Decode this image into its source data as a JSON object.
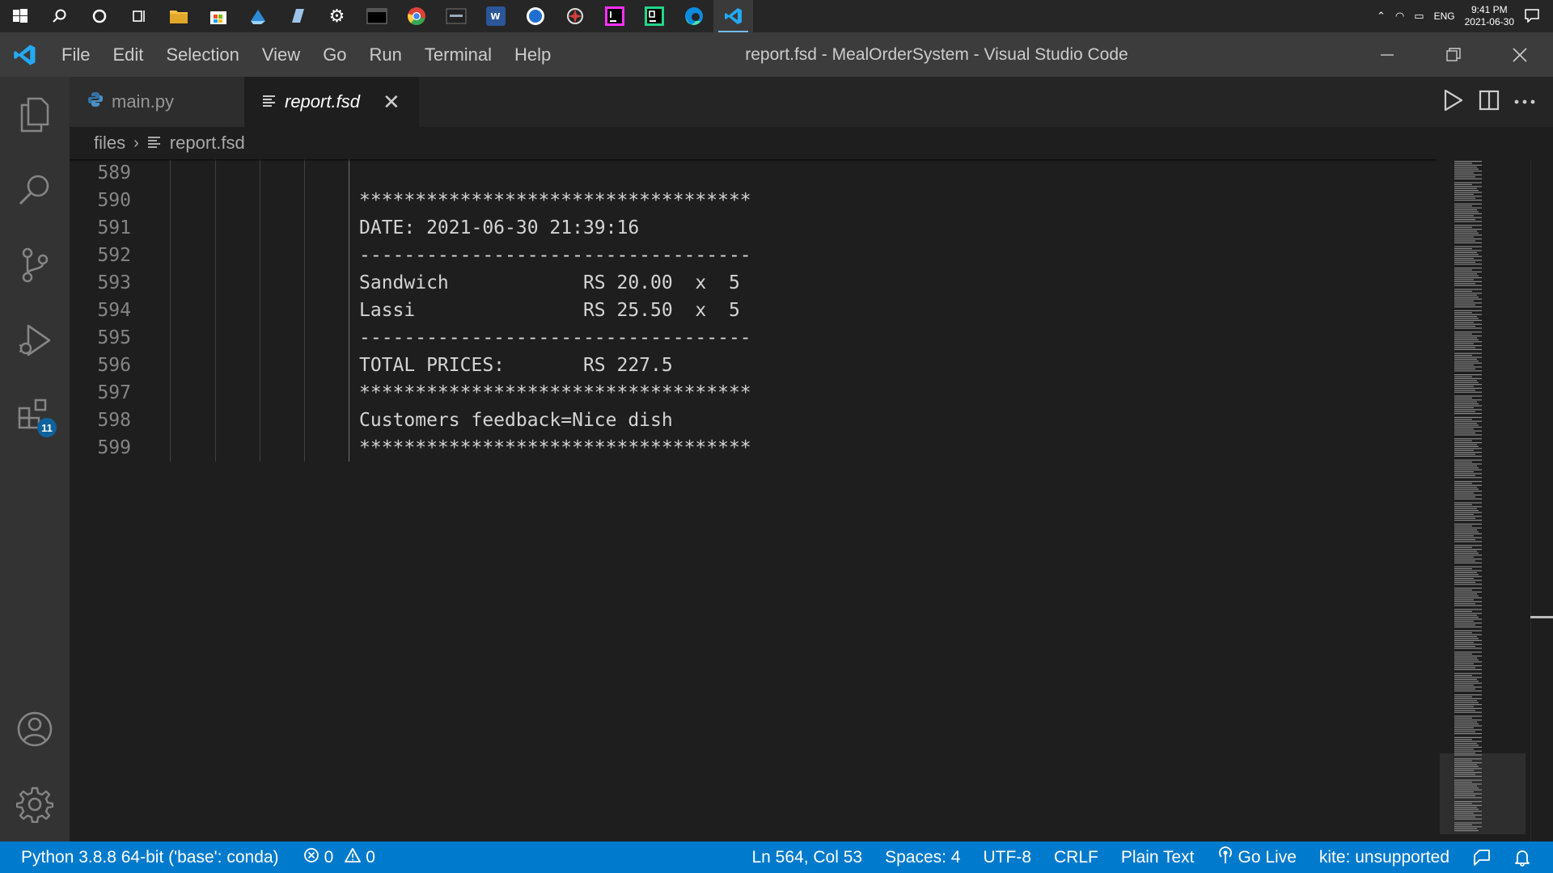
{
  "taskbar": {
    "icons": [
      {
        "name": "windows-start",
        "color": "#ffffff"
      },
      {
        "name": "search",
        "color": "#ffffff"
      },
      {
        "name": "cortana",
        "color": "#ffffff"
      },
      {
        "name": "task-view",
        "color": "#ffffff"
      },
      {
        "name": "file-explorer",
        "color": "#f4c046"
      },
      {
        "name": "microsoft-store",
        "color": "#ffffff"
      },
      {
        "name": "app-blue",
        "color": "#2e8bd8"
      },
      {
        "name": "app-notes",
        "color": "#9cc4e8"
      },
      {
        "name": "settings",
        "color": "#ffffff"
      },
      {
        "name": "terminal",
        "color": "#000000"
      },
      {
        "name": "chrome",
        "color": "#34a853"
      },
      {
        "name": "mysql-workbench",
        "color": "#222222"
      },
      {
        "name": "word",
        "color": "#2b579a"
      },
      {
        "name": "app-w-circle",
        "color": "#1f6fd1"
      },
      {
        "name": "app-web",
        "color": "#d04040"
      },
      {
        "name": "intellij",
        "color": "#000000"
      },
      {
        "name": "pycharm",
        "color": "#21d789"
      },
      {
        "name": "edge",
        "color": "#0c8ce0"
      },
      {
        "name": "vscode",
        "color": "#23a9f2"
      }
    ],
    "tray": {
      "language": "ENG",
      "time": "9:41 PM",
      "date": "2021-06-30"
    }
  },
  "titlebar": {
    "menu": [
      "File",
      "Edit",
      "Selection",
      "View",
      "Go",
      "Run",
      "Terminal",
      "Help"
    ],
    "title": "report.fsd - MealOrderSystem - Visual Studio Code"
  },
  "activitybar": {
    "extensions_badge": "11"
  },
  "tabs": [
    {
      "label": "main.py",
      "active": false
    },
    {
      "label": "report.fsd",
      "active": true
    }
  ],
  "breadcrumb": {
    "folder": "files",
    "file": "report.fsd"
  },
  "editor": {
    "lines": [
      {
        "num": "589",
        "text": ""
      },
      {
        "num": "590",
        "text": "***********************************"
      },
      {
        "num": "591",
        "text": "DATE: 2021-06-30 21:39:16"
      },
      {
        "num": "592",
        "text": "-----------------------------------"
      },
      {
        "num": "593",
        "text": "Sandwich            RS 20.00  x  5"
      },
      {
        "num": "594",
        "text": "Lassi               RS 25.50  x  5"
      },
      {
        "num": "595",
        "text": "-----------------------------------"
      },
      {
        "num": "596",
        "text": "TOTAL PRICES:       RS 227.5"
      },
      {
        "num": "597",
        "text": "***********************************"
      },
      {
        "num": "598",
        "text": "Customers feedback=Nice dish"
      },
      {
        "num": "599",
        "text": "***********************************"
      }
    ]
  },
  "statusbar": {
    "interpreter": "Python 3.8.8 64-bit ('base': conda)",
    "errors": "0",
    "warnings": "0",
    "cursor": "Ln 564, Col 53",
    "spaces": "Spaces: 4",
    "encoding": "UTF-8",
    "eol": "CRLF",
    "language": "Plain Text",
    "golive": "Go Live",
    "kite": "kite: unsupported"
  },
  "colors": {
    "statusbar": "#007acc",
    "titlebar": "#3c3c3c",
    "activitybar": "#333333",
    "editor_bg": "#1e1e1e",
    "vscode_blue": "#23a9f2"
  }
}
